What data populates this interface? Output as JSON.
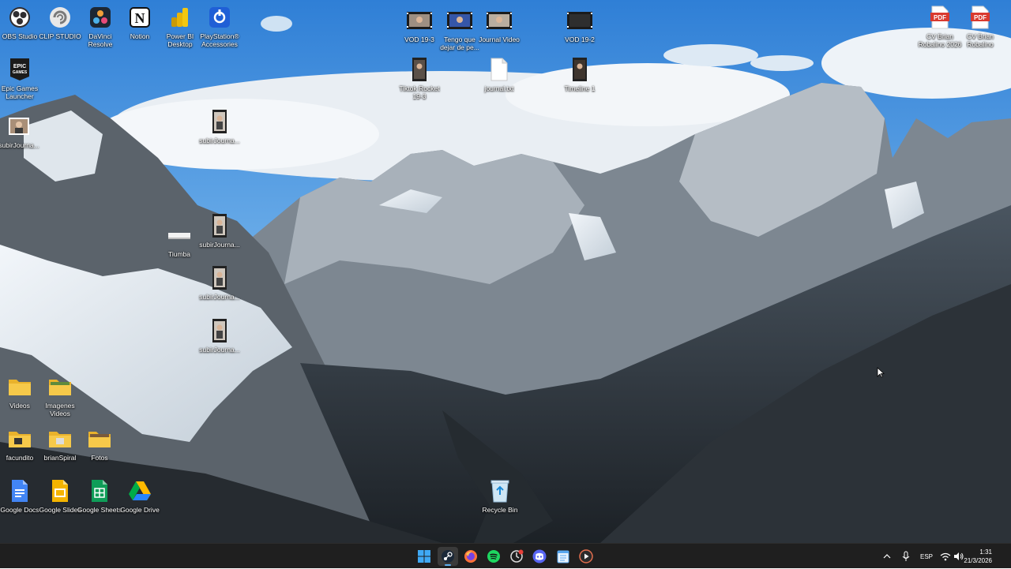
{
  "desktop": {
    "icons": [
      {
        "label": "OBS Studio",
        "icon": "obs-icon"
      },
      {
        "label": "CLIP STUDIO",
        "icon": "clip-studio-icon"
      },
      {
        "label": "DaVinci Resolve",
        "icon": "davinci-icon"
      },
      {
        "label": "Notion",
        "icon": "notion-icon"
      },
      {
        "label": "Power BI Desktop",
        "icon": "powerbi-icon"
      },
      {
        "label": "PlayStation® Accessories",
        "icon": "playstation-icon"
      },
      {
        "label": "Epic Games Launcher",
        "icon": "epic-icon"
      },
      {
        "label": "subirJourna...",
        "icon": "image-file-icon"
      },
      {
        "label": "subirJourna...",
        "icon": "video-file-icon"
      },
      {
        "label": "Tiumba",
        "icon": "image-file-icon"
      },
      {
        "label": "subirJourna...",
        "icon": "video-file-icon"
      },
      {
        "label": "subirJourna...",
        "icon": "video-file-icon"
      },
      {
        "label": "subirJourna...",
        "icon": "video-file-icon"
      },
      {
        "label": "VOD 19-3",
        "icon": "video-file-icon"
      },
      {
        "label": "Tengo que dejar de pe...",
        "icon": "video-file-icon"
      },
      {
        "label": "Journal Video",
        "icon": "video-file-icon"
      },
      {
        "label": "VOD 19-2",
        "icon": "video-file-icon"
      },
      {
        "label": "Tiktok Rocket 19-3",
        "icon": "video-file-icon"
      },
      {
        "label": "journal.txt",
        "icon": "text-file-icon"
      },
      {
        "label": "Timeline 1",
        "icon": "video-file-icon"
      },
      {
        "label": "CV Brian Robalino 2026",
        "icon": "pdf-icon"
      },
      {
        "label": "CV Brian Robalino",
        "icon": "pdf-icon"
      },
      {
        "label": "Videos",
        "icon": "folder-icon"
      },
      {
        "label": "Imagenes Videos",
        "icon": "folder-icon"
      },
      {
        "label": "facundito",
        "icon": "folder-icon"
      },
      {
        "label": "brianSpiral",
        "icon": "folder-icon"
      },
      {
        "label": "Fotos",
        "icon": "folder-icon"
      },
      {
        "label": "Google Docs",
        "icon": "google-docs-icon"
      },
      {
        "label": "Google Slides",
        "icon": "google-slides-icon"
      },
      {
        "label": "Google Sheets",
        "icon": "google-sheets-icon"
      },
      {
        "label": "Google Drive",
        "icon": "google-drive-icon"
      },
      {
        "label": "Recycle Bin",
        "icon": "recycle-bin-icon"
      }
    ]
  },
  "taskbar": {
    "apps": [
      "windows-start-icon",
      "steam-icon",
      "firefox-icon",
      "spotify-icon",
      "update-app-icon",
      "discord-icon",
      "notepad-icon",
      "media-player-icon"
    ],
    "tray": {
      "language": "ESP",
      "time": "1:31",
      "date": "21/3/2026"
    }
  },
  "colors": {
    "sky_top": "#3a86d8",
    "sky_bottom": "#8fc3ef",
    "taskbar": "#1f1f1f",
    "accent": "#5fb2f2",
    "pdf_red": "#d93a2f",
    "folder_yellow": "#f4c33d"
  }
}
